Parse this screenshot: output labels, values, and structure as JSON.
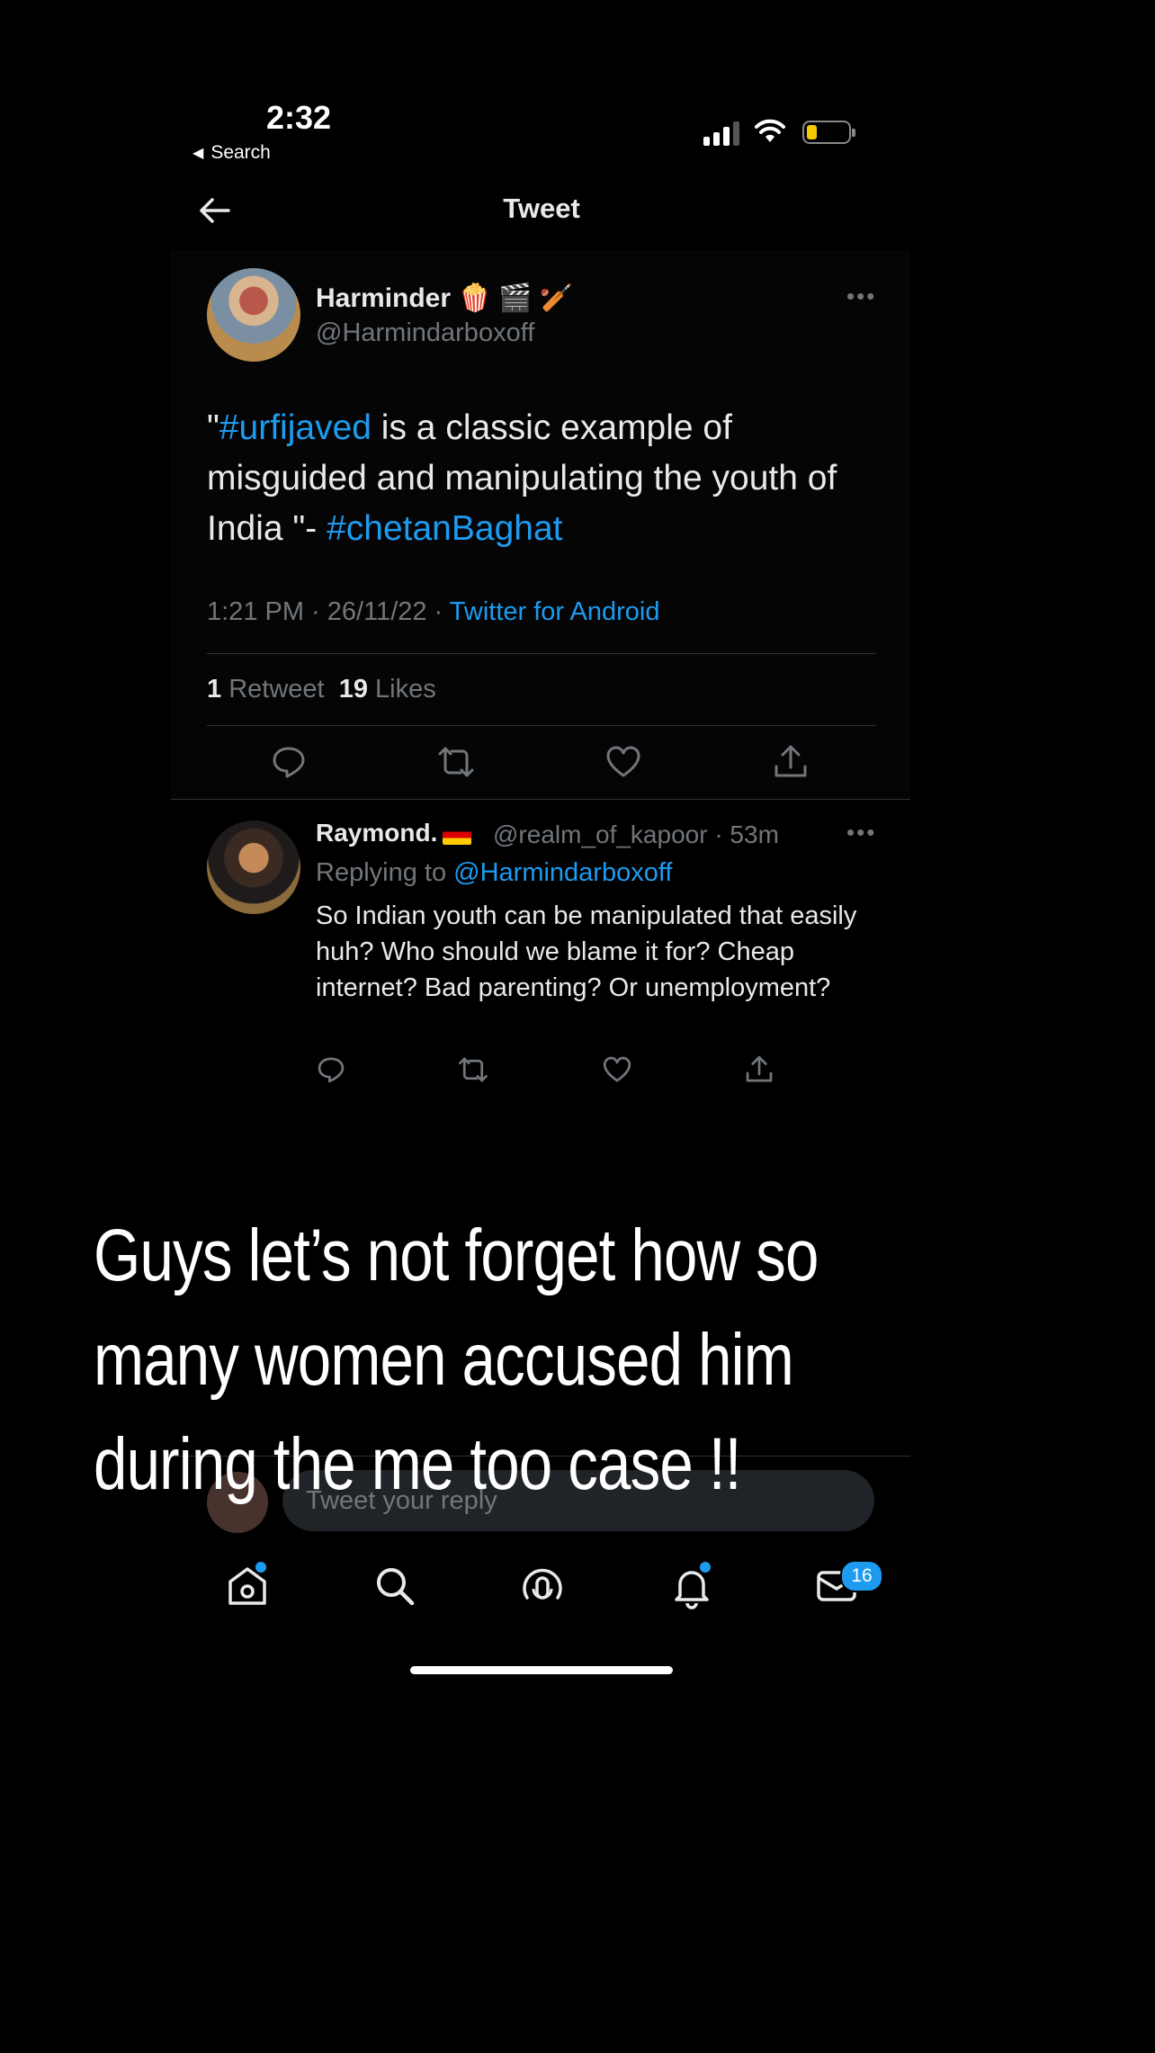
{
  "status_bar": {
    "time": "2:32",
    "back_label": "Search"
  },
  "header": {
    "title": "Tweet"
  },
  "tweet": {
    "author_name": "Harminder",
    "author_emojis": [
      "🍿",
      "🎬",
      "🏏"
    ],
    "author_handle": "@Harmindarboxoff",
    "text_parts": [
      {
        "text": "\"",
        "tag": false
      },
      {
        "text": "#urfijaved",
        "tag": true
      },
      {
        "text": " is a classic example of misguided and manipulating the youth of India \"- ",
        "tag": false
      },
      {
        "text": "#chetanBaghat",
        "tag": true
      }
    ],
    "time": "1:21 PM · 26/11/22 · ",
    "source": "Twitter for Android",
    "retweets_count": "1",
    "retweets_label": "Retweet",
    "likes_count": "19",
    "likes_label": "Likes"
  },
  "reply": {
    "author_name": "Raymond.",
    "author_handle": "@realm_of_kapoor · 53m",
    "replying_prefix": "Replying to ",
    "replying_to": "@Harmindarboxoff",
    "text": "So Indian youth can be manipulated that easily huh? Who should we blame it for? Cheap internet? Bad parenting? Or unemployment?"
  },
  "caption": "Guys let’s not forget  how so many women accused him during the me too case !!",
  "reply_input": {
    "placeholder": "Tweet your reply"
  },
  "nav": {
    "messages_badge": "16"
  },
  "colors": {
    "accent": "#1d9bf0",
    "muted": "#71767b",
    "text": "#e7e9ea",
    "background": "#000000"
  },
  "icons": [
    "back-arrow-icon",
    "more-icon",
    "reply-icon",
    "retweet-icon",
    "like-icon",
    "share-icon",
    "home-icon",
    "search-icon",
    "spaces-icon",
    "notifications-icon",
    "messages-icon"
  ]
}
